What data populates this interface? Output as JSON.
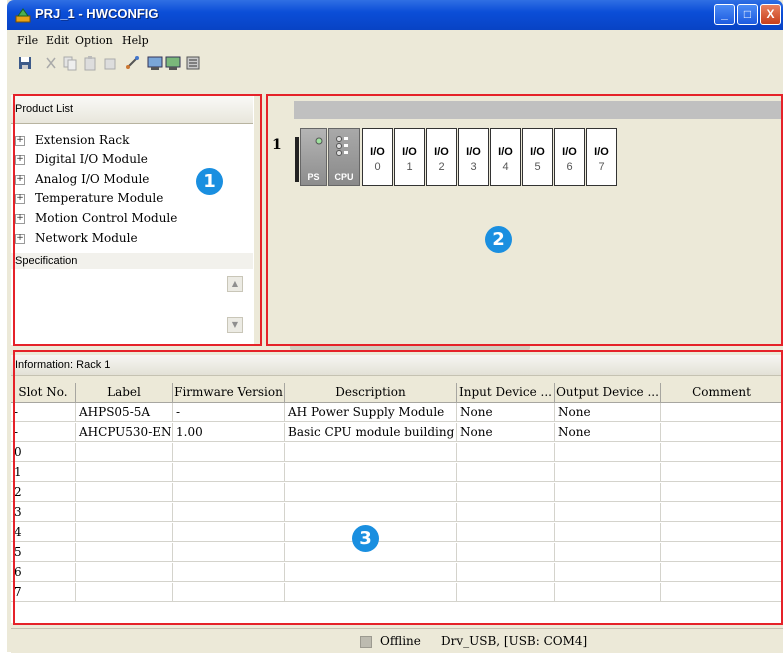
{
  "window": {
    "title": "PRJ_1 - HWCONFIG",
    "min": "_",
    "max": "□",
    "close": "X"
  },
  "menu": [
    "File",
    "Edit",
    "Option",
    "Help"
  ],
  "toolbar_icons": [
    "save-icon",
    "cut-icon",
    "copy-icon",
    "paste-icon",
    "delete-icon",
    "link-icon",
    "upload-icon",
    "download-icon",
    "scan-icon"
  ],
  "product_list": {
    "title": "Product List",
    "expander": "+",
    "items": [
      "Extension Rack",
      "Digital I/O Module",
      "Analog I/O Module",
      "Temperature Module",
      "Motion Control Module",
      "Network Module"
    ]
  },
  "specification": {
    "title": "Specification",
    "up": "▲",
    "down": "▼"
  },
  "rack": {
    "number": "1",
    "ps_label": "PS",
    "cpu_label": "CPU",
    "io_label": "I/O",
    "slots": [
      "0",
      "1",
      "2",
      "3",
      "4",
      "5",
      "6",
      "7"
    ]
  },
  "information": {
    "title": "Information: Rack 1"
  },
  "table": {
    "columns": [
      "Slot No.",
      "Label",
      "Firmware Version",
      "Description",
      "Input Device ...",
      "Output Device ...",
      "Comment"
    ],
    "rows": [
      [
        "-",
        "AHPS05-5A",
        "-",
        "AH Power Supply Module",
        "None",
        "None",
        ""
      ],
      [
        "-",
        "AHCPU530-EN",
        "1.00",
        "Basic CPU module building",
        "None",
        "None",
        ""
      ],
      [
        "0",
        "",
        "",
        "",
        "",
        "",
        ""
      ],
      [
        "1",
        "",
        "",
        "",
        "",
        "",
        ""
      ],
      [
        "2",
        "",
        "",
        "",
        "",
        "",
        ""
      ],
      [
        "3",
        "",
        "",
        "",
        "",
        "",
        ""
      ],
      [
        "4",
        "",
        "",
        "",
        "",
        "",
        ""
      ],
      [
        "5",
        "",
        "",
        "",
        "",
        "",
        ""
      ],
      [
        "6",
        "",
        "",
        "",
        "",
        "",
        ""
      ],
      [
        "7",
        "",
        "",
        "",
        "",
        "",
        ""
      ]
    ]
  },
  "status": {
    "state": "Offline",
    "connection": "Drv_USB, [USB: COM4]"
  },
  "callouts": [
    "1",
    "2",
    "3"
  ],
  "colors": {
    "titlebar": "#0b4ed8",
    "highlight": "#e52229",
    "badge": "#1a8fe0"
  }
}
